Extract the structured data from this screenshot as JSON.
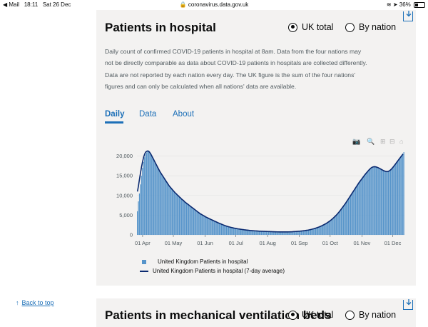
{
  "status_bar": {
    "back_app": "◀ Mail",
    "time": "18:11",
    "date": "Sat 26 Dec",
    "url": "coronavirus.data.gov.uk",
    "battery": "36%"
  },
  "section1": {
    "title": "Patients in hospital",
    "radio_uk": "UK total",
    "radio_nation": "By nation",
    "selected": "UK total",
    "description": "Daily count of confirmed COVID-19 patients in hospital at 8am. Data from the four nations may not be directly comparable as data about COVID-19 patients in hospitals are collected differently. Data are not reported by each nation every day. The UK figure is the sum of the four nations' figures and can only be calculated when all nations' data are available.",
    "tabs": [
      "Daily",
      "Data",
      "About"
    ],
    "active_tab": "Daily"
  },
  "modebar_icons": [
    "camera-icon",
    "zoom-icon",
    "zoom-in-icon",
    "zoom-out-icon",
    "home-icon"
  ],
  "legend": {
    "bars": "United Kingdom Patients in hospital",
    "line": "United Kingdom Patients in hospital (7-day average)"
  },
  "colors": {
    "bar": "#5694ca",
    "line": "#0b2a70",
    "link": "#1d70b8"
  },
  "section2": {
    "title": "Patients in mechanical ventilation beds",
    "radio_uk": "UK total",
    "radio_nation": "By nation"
  },
  "back_to_top": "Back to top",
  "chart_data": {
    "type": "bar",
    "xlabel": "",
    "ylabel": "",
    "ylim": [
      0,
      22000
    ],
    "yticks": [
      0,
      5000,
      10000,
      15000,
      20000
    ],
    "ytick_labels": [
      "0",
      "5,000",
      "10,000",
      "15,000",
      "20,000"
    ],
    "xtick_labels": [
      "01 Apr",
      "01 May",
      "01 Jun",
      "01 Jul",
      "01 Aug",
      "01 Sep",
      "01 Oct",
      "01 Nov",
      "01 Dec"
    ],
    "xtick_days": [
      5,
      35,
      66,
      96,
      127,
      158,
      188,
      219,
      249
    ],
    "start_date": "2020-03-27",
    "legend_position": "bottom",
    "series": [
      {
        "name": "United Kingdom Patients in hospital",
        "kind": "bar",
        "values": [
          6000,
          8500,
          10500,
          12800,
          15000,
          17000,
          18500,
          19700,
          20400,
          20900,
          21200,
          21300,
          21100,
          20700,
          20200,
          19600,
          19000,
          18500,
          18000,
          17500,
          17000,
          16500,
          16000,
          15600,
          15200,
          14800,
          14400,
          14000,
          13600,
          13200,
          12800,
          12400,
          12100,
          11800,
          11500,
          11200,
          10900,
          10600,
          10400,
          10100,
          9900,
          9600,
          9400,
          9100,
          8900,
          8700,
          8400,
          8200,
          8000,
          7800,
          7600,
          7400,
          7200,
          7000,
          6800,
          6600,
          6400,
          6200,
          6000,
          5800,
          5600,
          5400,
          5250,
          5100,
          4950,
          4800,
          4650,
          4500,
          4380,
          4250,
          4120,
          4000,
          3880,
          3760,
          3640,
          3520,
          3400,
          3280,
          3160,
          3040,
          2930,
          2820,
          2710,
          2600,
          2500,
          2400,
          2310,
          2220,
          2140,
          2060,
          1990,
          1920,
          1860,
          1800,
          1740,
          1690,
          1640,
          1590,
          1540,
          1500,
          1460,
          1420,
          1380,
          1340,
          1300,
          1270,
          1240,
          1210,
          1180,
          1150,
          1120,
          1100,
          1080,
          1060,
          1040,
          1020,
          1000,
          980,
          960,
          940,
          930,
          920,
          910,
          900,
          890,
          880,
          870,
          860,
          850,
          840,
          830,
          820,
          810,
          800,
          790,
          780,
          770,
          770,
          760,
          760,
          750,
          750,
          750,
          750,
          750,
          750,
          760,
          760,
          770,
          780,
          790,
          800,
          820,
          840,
          860,
          880,
          900,
          920,
          940,
          960,
          990,
          1020,
          1050,
          1080,
          1120,
          1160,
          1200,
          1250,
          1300,
          1360,
          1420,
          1490,
          1560,
          1640,
          1720,
          1810,
          1900,
          2000,
          2110,
          2220,
          2340,
          2470,
          2600,
          2740,
          2890,
          3050,
          3220,
          3400,
          3600,
          3800,
          4020,
          4250,
          4500,
          4750,
          5000,
          5300,
          5600,
          5900,
          6250,
          6600,
          6950,
          7300,
          7650,
          8000,
          8400,
          8800,
          9200,
          9600,
          10000,
          10400,
          10800,
          11200,
          11600,
          12000,
          12400,
          12800,
          13200,
          13550,
          13900,
          14250,
          14600,
          14950,
          15300,
          15600,
          15900,
          16200,
          16500,
          16750,
          17000,
          17200,
          17350,
          17400,
          17350,
          17300,
          17200,
          17100,
          16950,
          16800,
          16650,
          16500,
          16350,
          16200,
          16100,
          16050,
          16000,
          16100,
          16250,
          16450,
          16700,
          17000,
          17300,
          17650,
          18000,
          18350,
          18700,
          19050,
          19400,
          19750,
          20100,
          20600,
          21000
        ]
      },
      {
        "name": "United Kingdom Patients in hospital (7-day average)",
        "kind": "line",
        "values": [
          11000,
          12500,
          14200,
          15800,
          17300,
          18600,
          19700,
          20500,
          21000,
          21200,
          21300,
          21200,
          20900,
          20500,
          20000,
          19500,
          19000,
          18500,
          18000,
          17500,
          17000,
          16500,
          16000,
          15600,
          15200,
          14800,
          14400,
          14000,
          13600,
          13200,
          12800,
          12400,
          12100,
          11800,
          11500,
          11200,
          10900,
          10600,
          10400,
          10100,
          9900,
          9600,
          9400,
          9100,
          8900,
          8700,
          8400,
          8200,
          8000,
          7800,
          7600,
          7400,
          7200,
          7000,
          6800,
          6600,
          6400,
          6200,
          6000,
          5800,
          5600,
          5400,
          5250,
          5100,
          4950,
          4800,
          4650,
          4500,
          4380,
          4250,
          4120,
          4000,
          3880,
          3760,
          3640,
          3520,
          3400,
          3280,
          3160,
          3040,
          2930,
          2820,
          2710,
          2600,
          2500,
          2400,
          2310,
          2220,
          2140,
          2060,
          1990,
          1920,
          1860,
          1800,
          1740,
          1690,
          1640,
          1590,
          1540,
          1500,
          1460,
          1420,
          1380,
          1340,
          1300,
          1270,
          1240,
          1210,
          1180,
          1150,
          1120,
          1100,
          1080,
          1060,
          1040,
          1020,
          1000,
          980,
          960,
          940,
          930,
          920,
          910,
          900,
          890,
          880,
          870,
          860,
          850,
          840,
          830,
          820,
          810,
          800,
          790,
          780,
          770,
          770,
          760,
          760,
          750,
          750,
          750,
          750,
          750,
          750,
          760,
          760,
          770,
          780,
          790,
          800,
          820,
          840,
          860,
          880,
          900,
          920,
          940,
          960,
          990,
          1020,
          1050,
          1080,
          1120,
          1160,
          1200,
          1250,
          1300,
          1360,
          1420,
          1490,
          1560,
          1640,
          1720,
          1810,
          1900,
          2000,
          2110,
          2220,
          2340,
          2470,
          2600,
          2740,
          2890,
          3050,
          3220,
          3400,
          3600,
          3800,
          4020,
          4250,
          4500,
          4750,
          5000,
          5300,
          5600,
          5900,
          6250,
          6600,
          6950,
          7300,
          7650,
          8000,
          8400,
          8800,
          9200,
          9600,
          10000,
          10400,
          10800,
          11200,
          11600,
          12000,
          12400,
          12800,
          13200,
          13550,
          13900,
          14250,
          14600,
          14950,
          15300,
          15600,
          15900,
          16200,
          16500,
          16750,
          17000,
          17150,
          17250,
          17300,
          17280,
          17220,
          17130,
          17020,
          16890,
          16750,
          16600,
          16460,
          16320,
          16200,
          16110,
          16060,
          16060,
          16140,
          16290,
          16500,
          16760,
          17060,
          17380,
          17720,
          18070,
          18420,
          18770,
          19120,
          19470,
          19800,
          20150,
          20500
        ]
      }
    ]
  }
}
